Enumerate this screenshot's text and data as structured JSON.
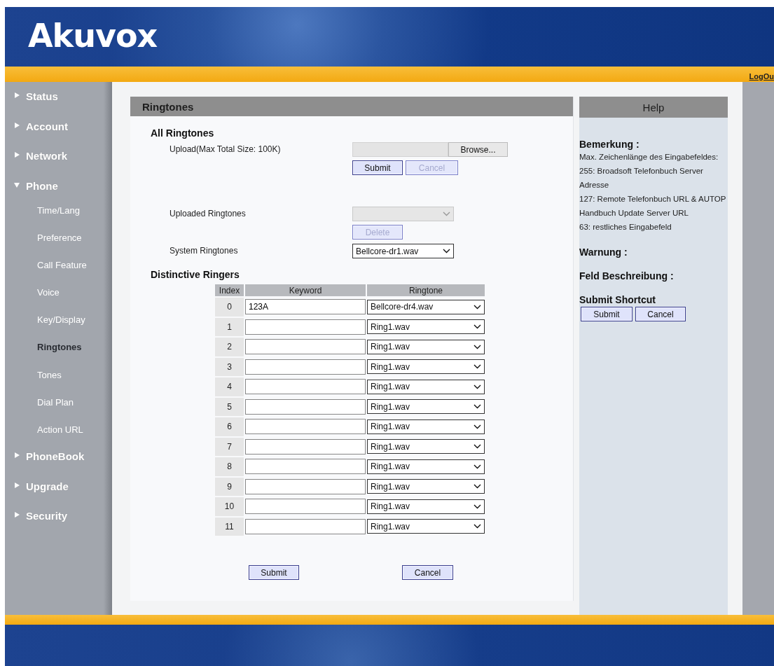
{
  "header": {
    "logo": "Akuvox"
  },
  "top_bar": {
    "logout_link": "LogOu"
  },
  "sidebar": {
    "items": [
      {
        "label": "Status",
        "expanded": false
      },
      {
        "label": "Account",
        "expanded": false
      },
      {
        "label": "Network",
        "expanded": false
      },
      {
        "label": "Phone",
        "expanded": true,
        "children": [
          {
            "label": "Time/Lang",
            "selected": false
          },
          {
            "label": "Preference",
            "selected": false
          },
          {
            "label": "Call Feature",
            "selected": false
          },
          {
            "label": "Voice",
            "selected": false
          },
          {
            "label": "Key/Display",
            "selected": false
          },
          {
            "label": "Ringtones",
            "selected": true
          },
          {
            "label": "Tones",
            "selected": false
          },
          {
            "label": "Dial Plan",
            "selected": false
          },
          {
            "label": "Action URL",
            "selected": false
          }
        ]
      },
      {
        "label": "PhoneBook",
        "expanded": false
      },
      {
        "label": "Upgrade",
        "expanded": false
      },
      {
        "label": "Security",
        "expanded": false
      }
    ]
  },
  "ringtones": {
    "title": "Ringtones",
    "all_ringtones": {
      "heading": "All Ringtones",
      "upload": {
        "label": "Upload(Max Total Size: 100K)",
        "browse_button": "Browse...",
        "submit_button": {
          "label": "Submit",
          "disabled": false
        },
        "cancel_button": {
          "label": "Cancel",
          "disabled": true
        }
      },
      "uploaded": {
        "label": "Uploaded Ringtones",
        "disabled": true,
        "delete_button": {
          "label": "Delete",
          "disabled": true
        }
      },
      "system": {
        "label": "System Ringtones",
        "value": "Bellcore-dr1.wav"
      }
    },
    "distinctive": {
      "heading": "Distinctive Ringers",
      "columns": [
        "Index",
        "Keyword",
        "Ringtone"
      ],
      "rows": [
        {
          "index": "0",
          "keyword": "123A",
          "ringtone": "Bellcore-dr4.wav"
        },
        {
          "index": "1",
          "ringtone": "Ring1.wav"
        },
        {
          "index": "2",
          "ringtone": "Ring1.wav"
        },
        {
          "index": "3",
          "ringtone": "Ring1.wav"
        },
        {
          "index": "4",
          "ringtone": "Ring1.wav"
        },
        {
          "index": "5",
          "ringtone": "Ring1.wav"
        },
        {
          "index": "6",
          "ringtone": "Ring1.wav"
        },
        {
          "index": "7",
          "ringtone": "Ring1.wav"
        },
        {
          "index": "8",
          "ringtone": "Ring1.wav"
        },
        {
          "index": "9",
          "ringtone": "Ring1.wav"
        },
        {
          "index": "10",
          "ringtone": "Ring1.wav"
        },
        {
          "index": "11",
          "ringtone": "Ring1.wav"
        }
      ]
    },
    "buttons": [
      "Submit",
      "Cancel"
    ]
  },
  "help": {
    "title": "Help",
    "sections": [
      {
        "heading": "Bemerkung :",
        "lines": [
          "Max. Zeichenlänge des Eingabefeldes:",
          "255: Broadsoft Telefonbuch Server Adresse",
          "127: Remote Telefonbuch URL & AUTOP Handbuch Update Server URL",
          "63: restliches Eingabefeld"
        ]
      },
      {
        "heading": "Warnung :"
      },
      {
        "heading": "Feld Beschreibung :"
      }
    ],
    "shortcut": {
      "heading": "Submit Shortcut",
      "buttons": [
        "Submit",
        "Cancel"
      ]
    }
  }
}
